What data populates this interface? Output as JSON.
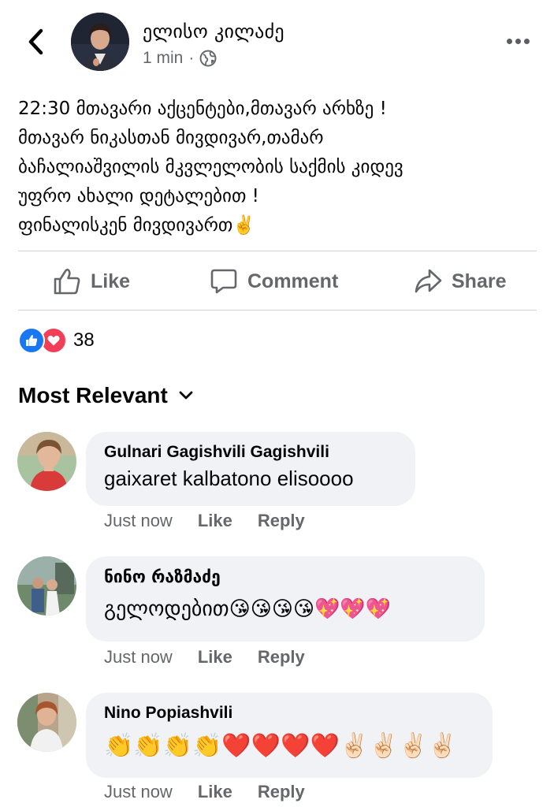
{
  "post": {
    "author_name": "ელისო კილაძე",
    "time": "1 min",
    "separator": "·",
    "privacy_icon": "globe-icon",
    "lines": [
      "22:30 მთავარი აქცენტები,მთავარ არხზე !",
      "მთავარ ნიკასთან მივდივარ,თამარ",
      "ბაჩალიაშვილის მკვლელობის საქმის კიდევ",
      "უფრო ახალი დეტალებით !",
      "ფინალისკენ მივდივართ✌️"
    ]
  },
  "actions": {
    "like": "Like",
    "comment": "Comment",
    "share": "Share"
  },
  "reactions": {
    "count": "38",
    "types": [
      "like",
      "love"
    ],
    "colors": {
      "like": "#1877f2",
      "love": "#f33e58"
    }
  },
  "comments_sort": {
    "label": "Most Relevant"
  },
  "comments": [
    {
      "author": "Gulnari Gagishvili Gagishvili",
      "text": "gaixaret kalbatono elisoooo",
      "time": "Just now",
      "like": "Like",
      "reply": "Reply"
    },
    {
      "author": "ნინო რაზმაძე",
      "text": "გელოდებით😘😘😘😘💖💖💖",
      "time": "Just now",
      "like": "Like",
      "reply": "Reply"
    },
    {
      "author": "Nino Popiashvili",
      "text": "👏👏👏👏❤️❤️❤️❤️✌🏻✌🏻✌🏻✌🏻",
      "time": "Just now",
      "like": "Like",
      "reply": "Reply"
    }
  ]
}
